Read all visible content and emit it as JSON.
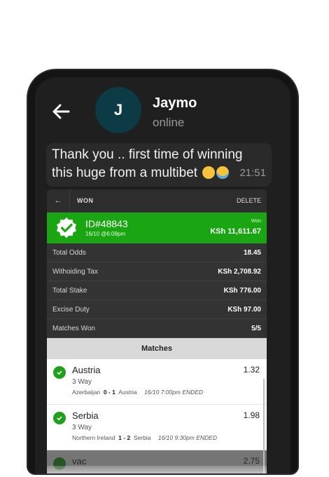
{
  "chat": {
    "contact_name": "Jaymo",
    "avatar_letter": "J",
    "status": "online",
    "message": {
      "text": "Thank you .. first time of winning this huge from a multibet",
      "time": "21:51"
    }
  },
  "bet": {
    "top_bar": {
      "back": "←",
      "title": "WON",
      "delete": "DELETE"
    },
    "banner": {
      "id": "ID#48843",
      "date": "16/10 @6:09pm",
      "status": "Won",
      "amount": "KSh 11,611.67"
    },
    "rows": [
      {
        "label": "Total Odds",
        "value": "18.45"
      },
      {
        "label": "Withoiding Tax",
        "value": "KSh 2,708.92"
      },
      {
        "label": "Total Stake",
        "value": "KSh 776.00"
      },
      {
        "label": "Excise Duty",
        "value": "KSh 97.00"
      },
      {
        "label": "Matches Won",
        "value": "5/5"
      }
    ],
    "matches_header": "Matches",
    "matches": [
      {
        "pick": "Austria",
        "odds": "1.32",
        "market": "3 Way",
        "home": "Azerbaijan",
        "score": "0 - 1",
        "away": "Austria",
        "info": "16/10 7:00pm ENDED"
      },
      {
        "pick": "Serbia",
        "odds": "1.98",
        "market": "3 Way",
        "home": "Northern Ireland",
        "score": "1 - 2",
        "away": "Serbia",
        "info": "16/10 9:30pm ENDED"
      },
      {
        "pick": "vac",
        "odds": "2.75"
      }
    ]
  },
  "colors": {
    "win_green": "#1aa512",
    "check_green": "#1ea01a",
    "avatar_bg": "#0c3a45",
    "chat_bg": "#1f1f1f"
  }
}
